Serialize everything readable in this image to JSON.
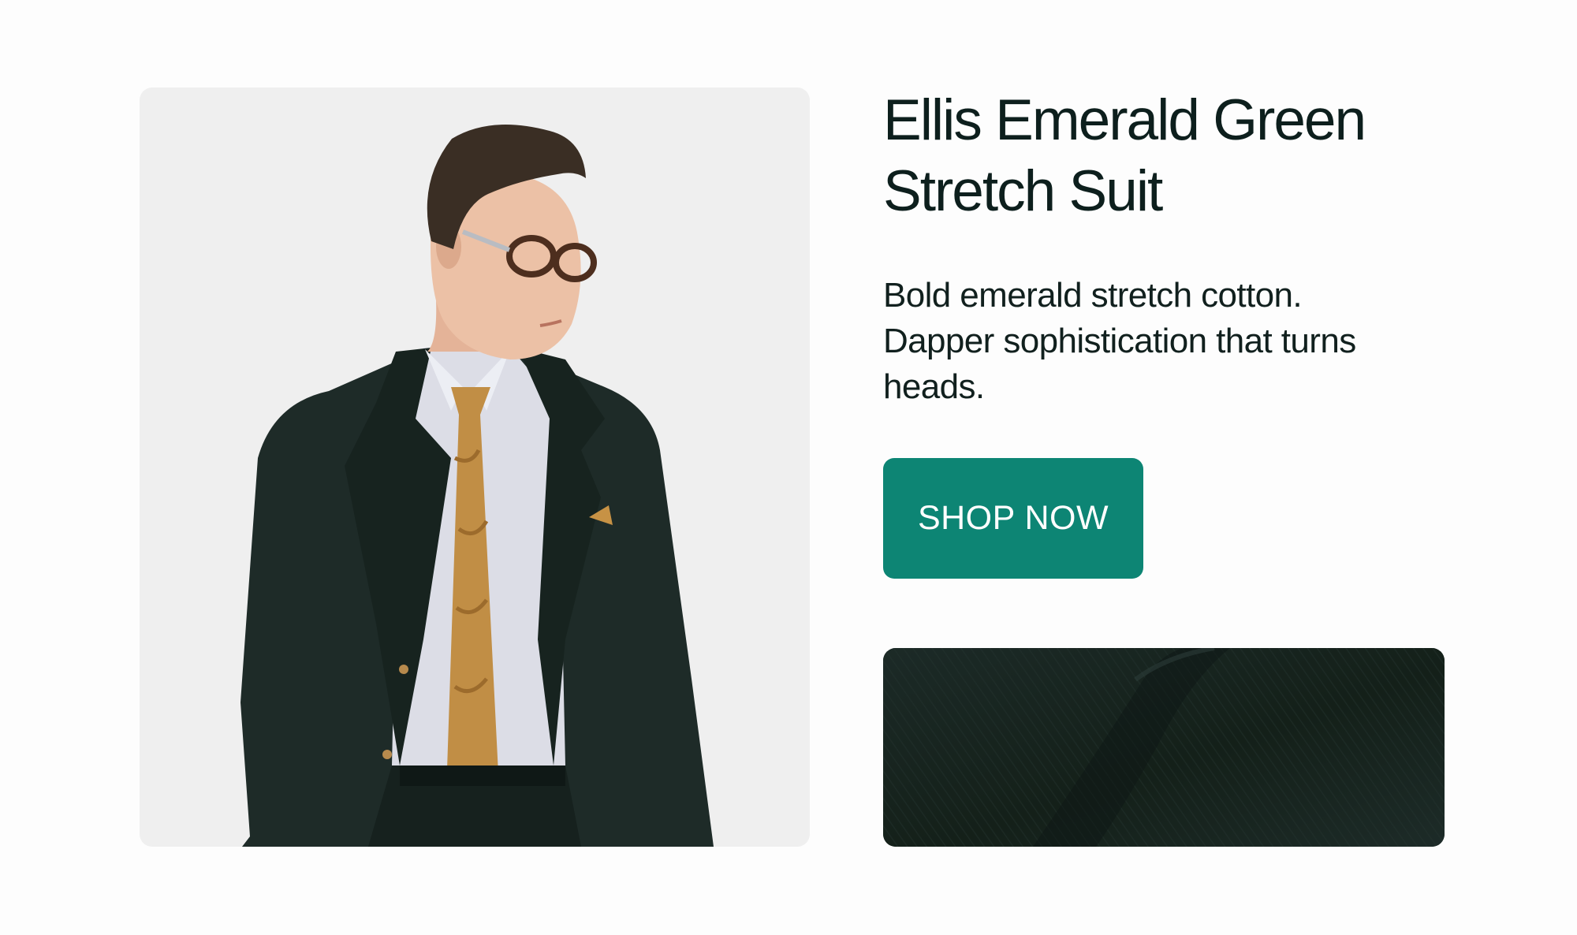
{
  "product": {
    "title": "Ellis Emerald Green Stretch Suit",
    "description": "Bold emerald stretch cotton. Dapper sophistication that turns heads.",
    "cta_label": "SHOP NOW"
  },
  "colors": {
    "page_background": "#fdfdfd",
    "photo_background": "#efefef",
    "title_text": "#0d1f1d",
    "cta_background": "#0d8574",
    "cta_text": "#ffffff",
    "fabric": "#1a2724"
  }
}
